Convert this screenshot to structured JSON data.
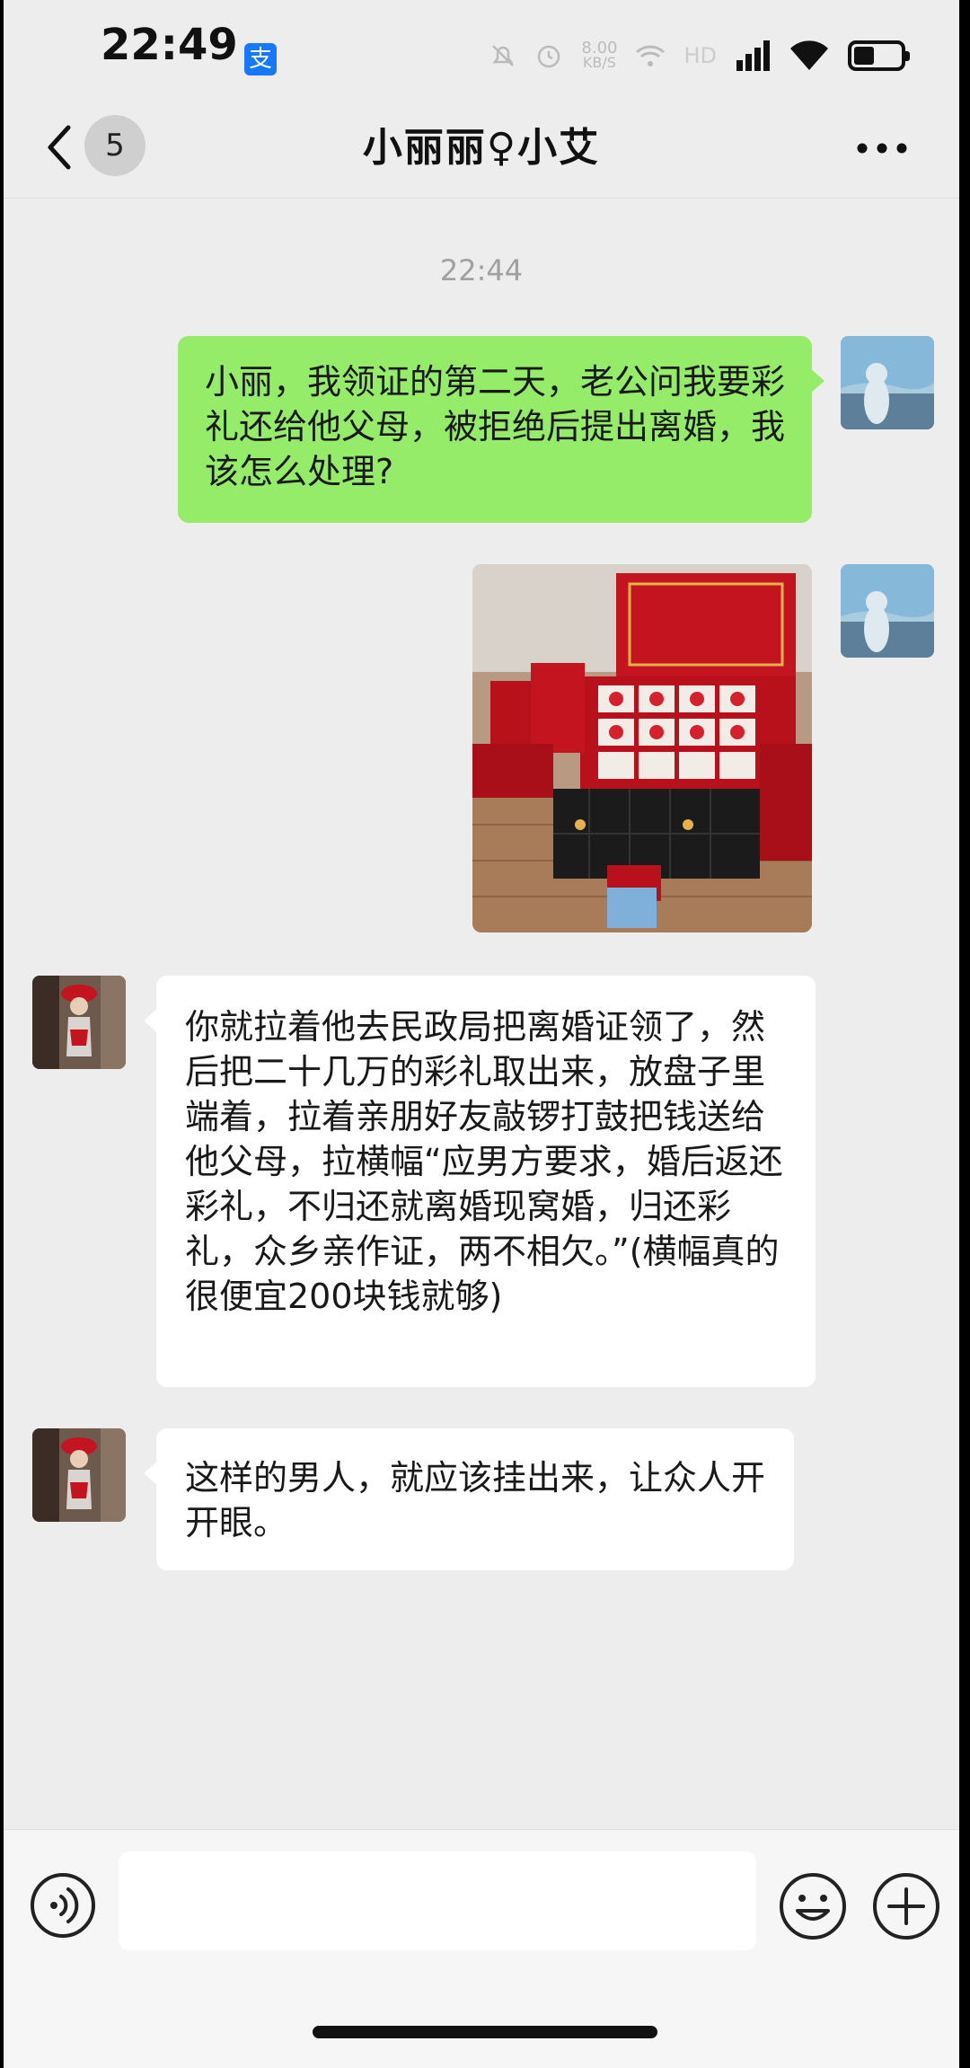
{
  "status_bar": {
    "time": "22:49",
    "net_speed_value": "8.00",
    "net_speed_unit": "KB/S",
    "network_label": "HD"
  },
  "header": {
    "title": "小丽丽♀小艾",
    "unread_count": "5"
  },
  "chat": {
    "timestamp": "22:44",
    "messages": [
      {
        "sender": "me",
        "type": "text",
        "text": "小丽，我领证的第二天，老公问我要彩礼还给他父母，被拒绝后提出离婚，我该怎么处理?"
      },
      {
        "sender": "me",
        "type": "image",
        "description": "red bride-price box with money and jewelry"
      },
      {
        "sender": "other",
        "type": "text",
        "text": "你就拉着他去民政局把离婚证领了，然后把二十几万的彩礼取出来，放盘子里端着，拉着亲朋好友敲锣打鼓把钱送给他父母，拉横幅“应男方要求，婚后返还彩礼，不归还就离婚现窝婚，归还彩礼，众乡亲作证，两不相欠。”(横幅真的很便宜200块钱就够)"
      },
      {
        "sender": "other",
        "type": "text",
        "text": "这样的男人，就应该挂出来，让众人开开眼。"
      }
    ]
  },
  "colors": {
    "bg": "#ededed",
    "my_bubble": "#95ec69",
    "other_bubble": "#ffffff",
    "alipay": "#1677ff"
  },
  "icons": [
    "back-chevron-icon",
    "more-icon",
    "voice-icon",
    "emoji-icon",
    "plus-icon",
    "alipay-icon",
    "wifi-icon",
    "signal-icon",
    "battery-icon",
    "mute-icon",
    "alarm-icon"
  ]
}
